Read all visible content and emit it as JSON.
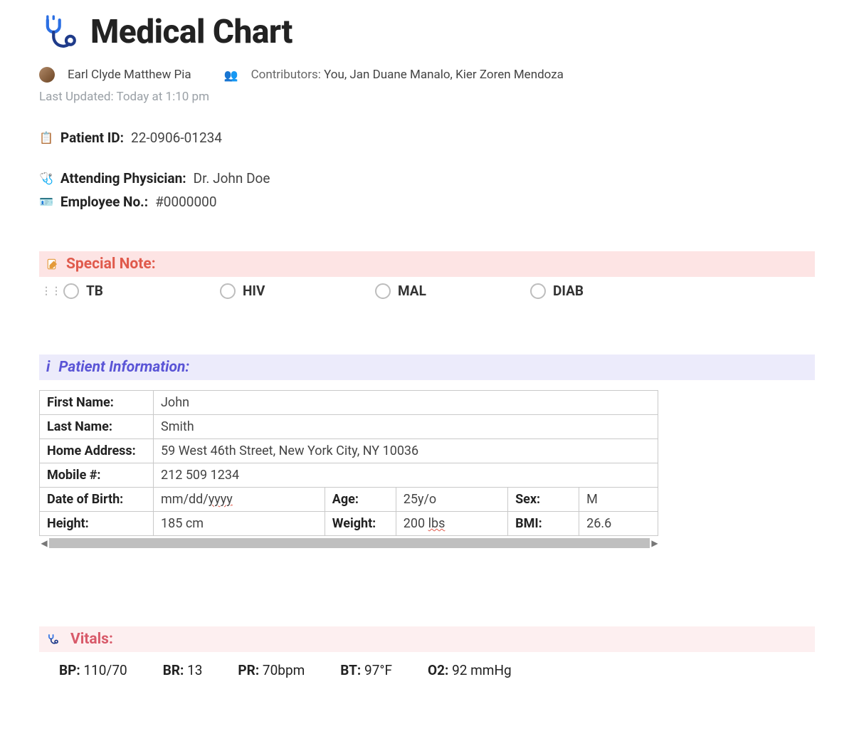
{
  "header": {
    "title": "Medical Chart",
    "author": "Earl Clyde Matthew Pia",
    "contributors_label": "Contributors:",
    "contributors": "You, Jan Duane Manalo, Kier Zoren Mendoza",
    "last_updated_label": "Last Updated:",
    "last_updated_value": "Today at 1:10 pm"
  },
  "meta": {
    "patient_id_label": "Patient ID:",
    "patient_id_value": "22-0906-01234",
    "physician_label": "Attending Physician:",
    "physician_value": "Dr. John Doe",
    "employee_label": "Employee No.:",
    "employee_value": "#0000000"
  },
  "special_note": {
    "title": "Special Note:",
    "items": [
      "TB",
      "HIV",
      "MAL",
      "DIAB"
    ]
  },
  "patient_info": {
    "title": "Patient Information:",
    "rows": {
      "first_name_label": "First Name:",
      "first_name_value": "John",
      "last_name_label": "Last Name:",
      "last_name_value": "Smith",
      "address_label": "Home Address:",
      "address_value": "59 West 46th Street, New York City, NY 10036",
      "mobile_label": "Mobile #:",
      "mobile_value": "212 509 1234",
      "dob_label": "Date of Birth:",
      "dob_value_prefix": "mm/dd/",
      "dob_value_typo": "yyyy",
      "age_label": "Age:",
      "age_value": "25y/o",
      "sex_label": "Sex:",
      "sex_value": "M",
      "height_label": "Height:",
      "height_value": "185 cm",
      "weight_label": "Weight:",
      "weight_value_num": "200 ",
      "weight_value_typo": "lbs",
      "bmi_label": "BMI:",
      "bmi_value": "26.6"
    }
  },
  "vitals": {
    "title": "Vitals:",
    "items": [
      {
        "k": "BP:",
        "v": "110/70"
      },
      {
        "k": "BR:",
        "v": "13"
      },
      {
        "k": "PR:",
        "v": "70bpm"
      },
      {
        "k": "BT:",
        "v": "97°F"
      },
      {
        "k": "O2:",
        "v": "92 mmHg"
      }
    ]
  }
}
